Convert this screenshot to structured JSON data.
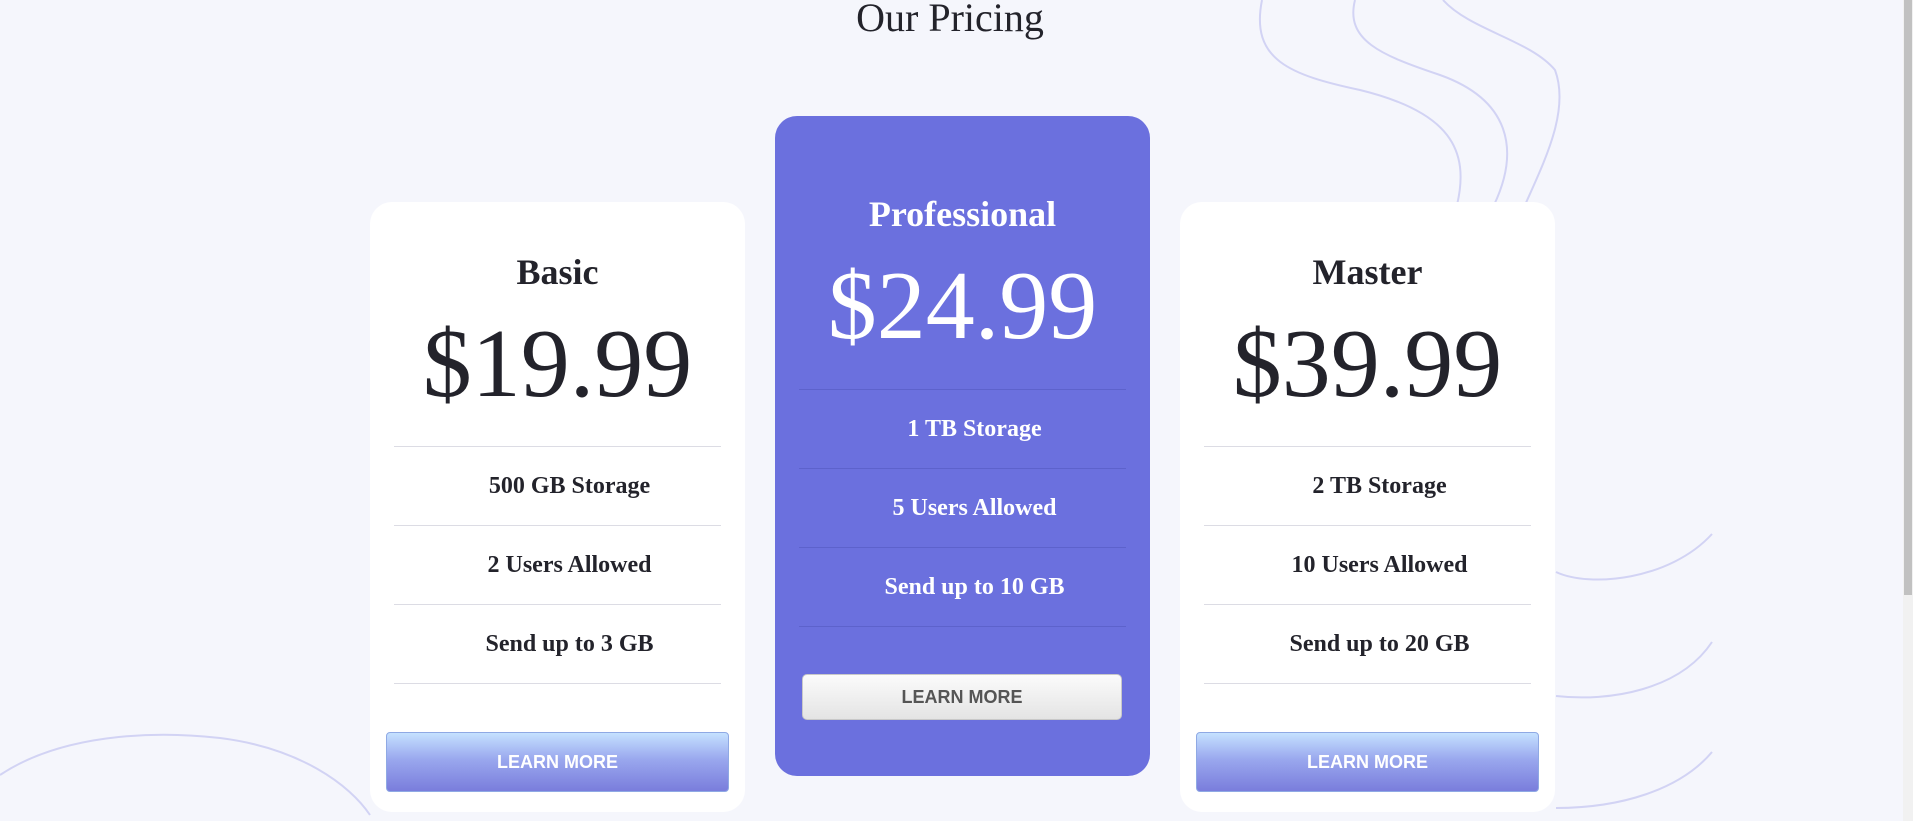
{
  "page": {
    "title": "Our Pricing"
  },
  "plans": [
    {
      "name": "Basic",
      "price": "$19.99",
      "features": [
        "500 GB Storage",
        "2 Users Allowed",
        "Send up to 3 GB"
      ],
      "button_label": "LEARN MORE"
    },
    {
      "name": "Professional",
      "price": "$24.99",
      "features": [
        "1 TB Storage",
        "5 Users Allowed",
        "Send up to 10 GB"
      ],
      "button_label": "LEARN MORE"
    },
    {
      "name": "Master",
      "price": "$39.99",
      "features": [
        "2 TB Storage",
        "10 Users Allowed",
        "Send up to 20 GB"
      ],
      "button_label": "LEARN MORE"
    }
  ],
  "colors": {
    "background": "#f5f6fc",
    "highlight_card": "#6b70de",
    "decor_lines": "#d2d3f4"
  }
}
